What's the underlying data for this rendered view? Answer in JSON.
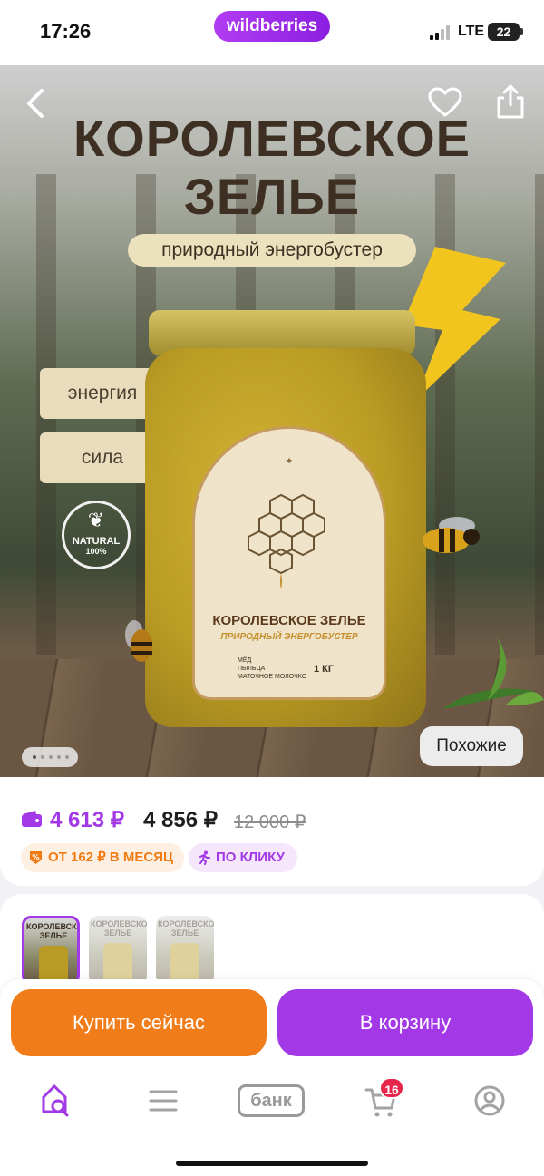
{
  "status_bar": {
    "time": "17:26",
    "brand_pill": "wildberries",
    "network": "LTE",
    "battery": "22"
  },
  "hero": {
    "title_line1": "КОРОЛЕВСКОЕ",
    "title_line2": "ЗЕЛЬЕ",
    "subtitle": "природный энергобустер",
    "tags": [
      "энергия",
      "сила"
    ],
    "badge_line1": "NATURAL",
    "badge_line2": "100%",
    "jar_label": {
      "title": "КОРОЛЕВСКОЕ ЗЕЛЬЕ",
      "subtitle": "ПРИРОДНЫЙ ЭНЕРГОБУСТЕР",
      "ingredients": [
        "МЁД",
        "ПЫЛЬЦА",
        "МАТОЧНОЕ МОЛОЧКО"
      ],
      "weight": "1 КГ"
    },
    "similar_button": "Похожие",
    "gallery_dots": 5,
    "gallery_active": 1
  },
  "price": {
    "wallet_price": "4 613 ₽",
    "price": "4 856 ₽",
    "old_price": "12 000 ₽",
    "installment": "ОТ 162 ₽ В МЕСЯЦ",
    "quick_buy": "ПО КЛИКУ"
  },
  "thumbnails": [
    {
      "title": "КОРОЛЕВСКОЕ ЗЕЛЬЕ",
      "selected": true
    },
    {
      "title": "КОРОЛЕВСКОЕ ЗЕЛЬЕ",
      "selected": false
    },
    {
      "title": "КОРОЛЕВСКОЕ ЗЕЛЬЕ",
      "selected": false
    }
  ],
  "actions": {
    "buy_now": "Купить сейчас",
    "add_to_cart": "В корзину"
  },
  "tab_bar": {
    "bank_label": "банк",
    "cart_count": "16"
  },
  "colors": {
    "brand_purple": "#a238e6",
    "buy_orange": "#f07d1a",
    "badge_red": "#e7254b"
  },
  "icons": [
    "back-arrow-icon",
    "heart-icon",
    "share-icon",
    "wallet-icon",
    "installment-icon",
    "running-icon",
    "home-search-icon",
    "catalog-menu-icon",
    "cart-icon",
    "profile-icon"
  ]
}
